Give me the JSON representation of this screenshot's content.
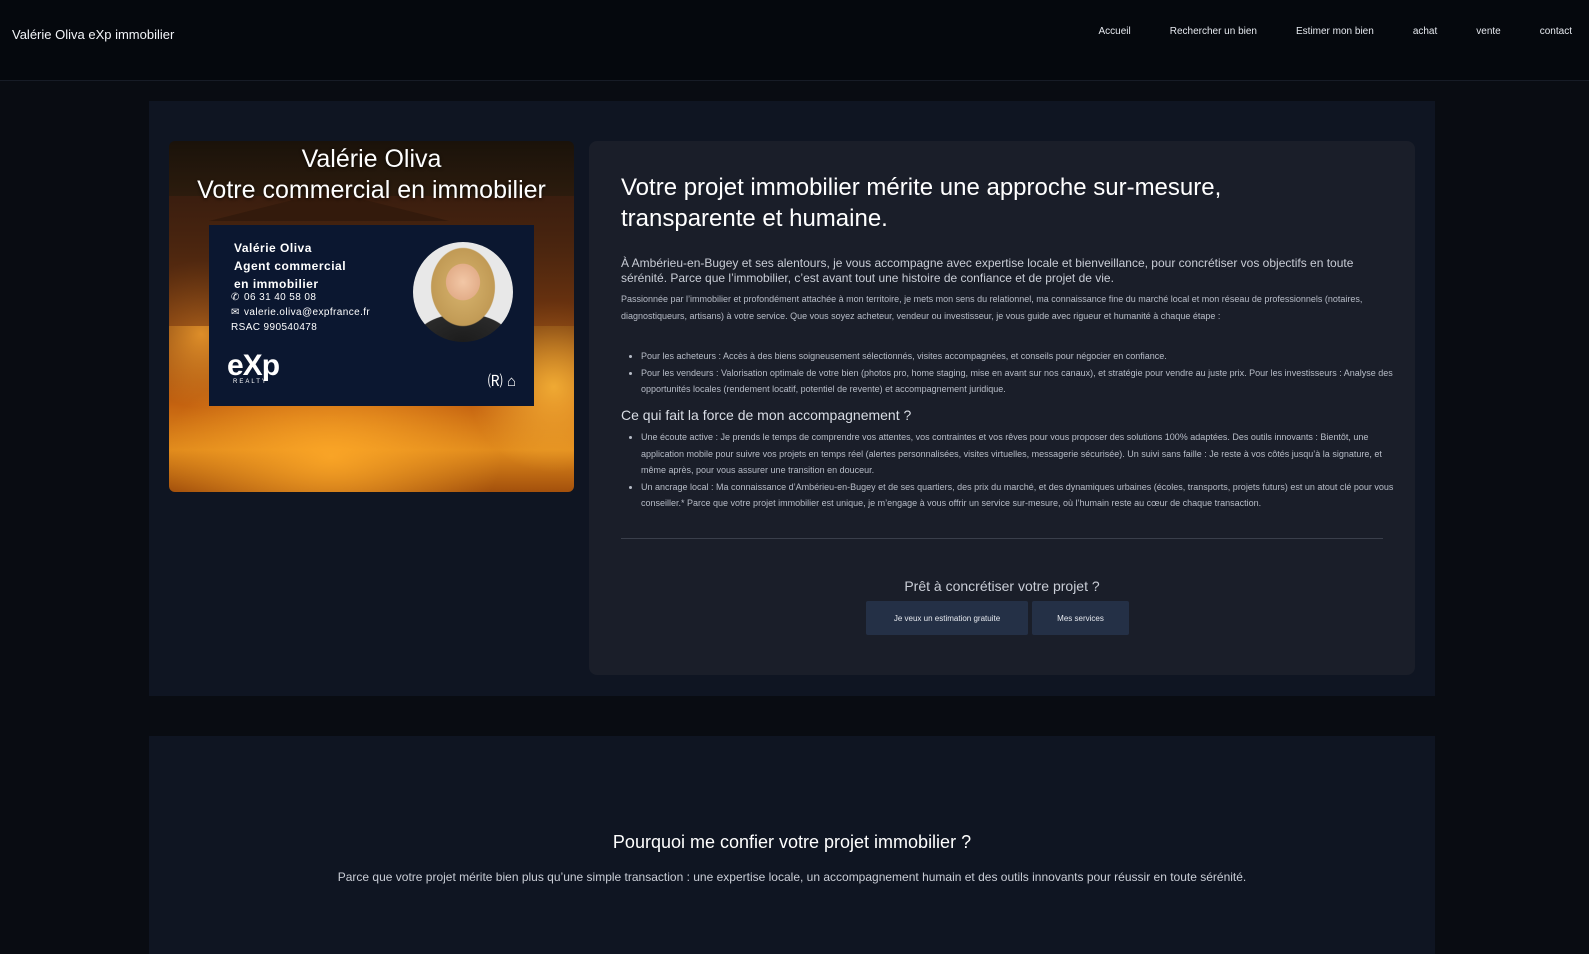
{
  "header": {
    "brand": "Valérie Oliva eXp immobilier",
    "nav": [
      "Accueil",
      "Rechercher un bien",
      "Estimer mon bien",
      "achat",
      "vente",
      "contact"
    ]
  },
  "hero_image": {
    "title_line1": "Valérie Oliva",
    "title_line2": "Votre commercial en immobilier",
    "card": {
      "name_line1": "Valérie Oliva",
      "name_line2": "Agent commercial",
      "name_line3": "en immobilier",
      "phone": "06 31 40 58 08",
      "email": "valerie.oliva@expfrance.fr",
      "rsac": "RSAC 990540478",
      "logo": "eXp",
      "logo_sub": "REALTY"
    }
  },
  "main": {
    "title": "Votre projet immobilier mérite une approche sur-mesure, transparente et humaine.",
    "intro": "À Ambérieu-en-Bugey et ses alentours, je vous accompagne avec expertise locale et bienveillance, pour concrétiser vos objectifs en toute sérénité. Parce que l’immobilier, c’est avant tout une histoire de confiance et de projet de vie.",
    "body": "Passionnée par l’immobilier et profondément attachée à mon territoire, je mets mon sens du relationnel, ma connaissance fine du marché local et mon réseau de professionnels (notaires, diagnostiqueurs, artisans) à votre service. Que vous soyez acheteur, vendeur ou investisseur, je vous guide avec rigueur et humanité à chaque étape :",
    "list1": [
      "Pour les acheteurs : Accès à des biens soigneusement sélectionnés, visites accompagnées, et conseils pour négocier en confiance.",
      "Pour les vendeurs : Valorisation optimale de votre bien (photos pro, home staging, mise en avant sur nos canaux), et stratégie pour vendre au juste prix. Pour les investisseurs : Analyse des opportunités locales (rendement locatif, potentiel de revente) et accompagnement juridique."
    ],
    "subtitle": "Ce qui fait la force de mon accompagnement ?",
    "list2": [
      "Une écoute active : Je prends le temps de comprendre vos attentes, vos contraintes et vos rêves pour vous proposer des solutions 100% adaptées. Des outils innovants : Bientôt, une application mobile pour suivre vos projets en temps réel (alertes personnalisées, visites virtuelles, messagerie sécurisée). Un suivi sans faille : Je reste à vos côtés jusqu’à la signature, et même après, pour vous assurer une transition en douceur.",
      "Un ancrage local : Ma connaissance d’Ambérieu-en-Bugey et de ses quartiers, des prix du marché, et des dynamiques urbaines (écoles, transports, projets futurs) est un atout clé pour vous conseiller.* Parce que votre projet immobilier est unique, je m’engage à vous offrir un service sur-mesure, où l’humain reste au cœur de chaque transaction."
    ],
    "cta_question": "Prêt à concrétiser votre projet ?",
    "btn_estimate": "Je veux un estimation gratuite",
    "btn_services": "Mes services"
  },
  "why": {
    "title": "Pourquoi me confier votre projet immobilier ?",
    "text": "Parce que votre projet mérite bien plus qu’une simple transaction : une expertise locale, un accompagnement humain et des outils innovants pour réussir en toute sérénité."
  },
  "colors": {
    "page_bg": "#090c12",
    "section_bg": "#0f1522",
    "card_bg": "#1a1e29",
    "button_bg": "#243046"
  }
}
